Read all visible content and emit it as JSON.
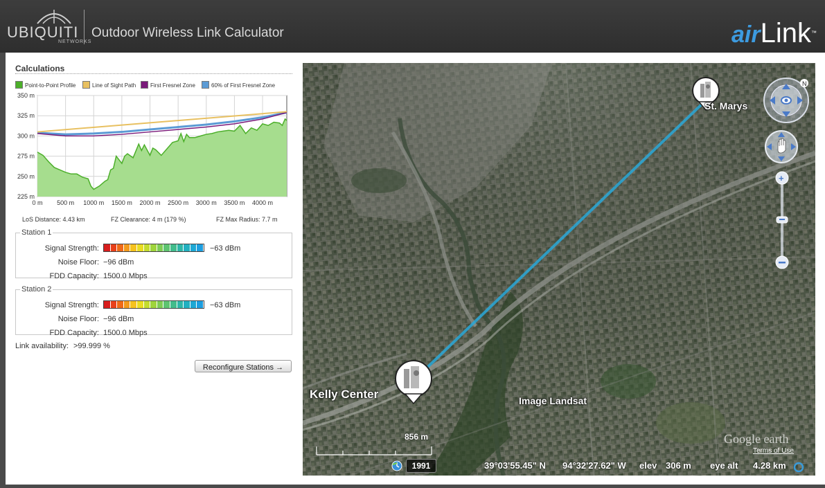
{
  "header": {
    "logo_text": "UBIQUITI",
    "logo_sub": "NETWORKS",
    "title": "Outdoor Wireless Link Calculator",
    "brand_air": "air",
    "brand_link": "Link",
    "brand_tm": "™"
  },
  "calculations": {
    "title": "Calculations",
    "legend": [
      {
        "label": "Point-to-Point Profile",
        "color": "#4caf2a"
      },
      {
        "label": "Line of Sight Path",
        "color": "#e8c060"
      },
      {
        "label": "First Fresnel Zone",
        "color": "#7a1a7a"
      },
      {
        "label": "60% of First Fresnel Zone",
        "color": "#5b9bd5"
      }
    ],
    "stats": {
      "los_distance": "LoS Distance: 4.43 km",
      "fz_clearance": "FZ Clearance: 4 m  (179 %)",
      "fz_max_radius": "FZ Max Radius: 7.7 m"
    }
  },
  "chart_data": {
    "type": "area",
    "title": "",
    "xlabel": "",
    "ylabel": "",
    "x_ticks": [
      "0 m",
      "500 m",
      "1000 m",
      "1500 m",
      "2000 m",
      "2500 m",
      "3000 m",
      "3500 m",
      "4000 m"
    ],
    "y_ticks": [
      "225 m",
      "250 m",
      "275 m",
      "300 m",
      "325 m",
      "350 m"
    ],
    "xlim": [
      0,
      4430
    ],
    "ylim": [
      225,
      350
    ],
    "grid": true,
    "series": [
      {
        "name": "Point-to-Point Profile",
        "color": "#4caf2a",
        "x": [
          0,
          100,
          200,
          300,
          400,
          500,
          600,
          700,
          800,
          900,
          950,
          1000,
          1100,
          1200,
          1250,
          1300,
          1350,
          1400,
          1500,
          1550,
          1600,
          1700,
          1800,
          1850,
          1900,
          2000,
          2050,
          2100,
          2200,
          2300,
          2400,
          2500,
          2550,
          2600,
          2650,
          2700,
          2800,
          2900,
          3000,
          3100,
          3200,
          3300,
          3400,
          3500,
          3600,
          3700,
          3800,
          3900,
          4000,
          4100,
          4200,
          4300,
          4350,
          4400,
          4430
        ],
        "y": [
          280,
          276,
          268,
          261,
          258,
          255,
          253,
          253,
          249,
          247,
          238,
          234,
          238,
          244,
          246,
          258,
          260,
          275,
          266,
          275,
          278,
          273,
          290,
          282,
          289,
          276,
          285,
          283,
          276,
          284,
          292,
          294,
          303,
          293,
          302,
          298,
          298,
          300,
          302,
          303,
          305,
          306,
          307,
          306,
          313,
          303,
          310,
          307,
          315,
          313,
          317,
          316,
          313,
          321,
          319
        ]
      },
      {
        "name": "Line of Sight Path",
        "color": "#e8c060",
        "x": [
          0,
          4430
        ],
        "y": [
          305,
          330
        ]
      },
      {
        "name": "First Fresnel Zone",
        "color": "#7a1a7a",
        "x": [
          0,
          500,
          1000,
          1500,
          2000,
          2500,
          3000,
          3500,
          4000,
          4430
        ],
        "y": [
          303,
          300,
          300,
          302,
          305,
          308,
          311,
          315,
          321,
          329
        ]
      },
      {
        "name": "60% of First Fresnel Zone",
        "color": "#5b9bd5",
        "x": [
          0,
          500,
          1000,
          1500,
          2000,
          2500,
          3000,
          3500,
          4000,
          4430
        ],
        "y": [
          304,
          302,
          303,
          305,
          308,
          311,
          314,
          318,
          323,
          329
        ]
      }
    ]
  },
  "stations": [
    {
      "legend": "Station 1",
      "signal_label": "Signal Strength:",
      "signal_value": "−63 dBm",
      "noise_label": "Noise Floor:",
      "noise_value": "−96 dBm",
      "capacity_label": "FDD Capacity:",
      "capacity_value": "1500.0 Mbps"
    },
    {
      "legend": "Station 2",
      "signal_label": "Signal Strength:",
      "signal_value": "−63 dBm",
      "noise_label": "Noise Floor:",
      "noise_value": "−96 dBm",
      "capacity_label": "FDD Capacity:",
      "capacity_value": "1500.0 Mbps"
    }
  ],
  "meter_colors": [
    "#d81e1e",
    "#e8401a",
    "#ef6a18",
    "#f29a1c",
    "#f5c21e",
    "#e9dc22",
    "#c4dc2e",
    "#9fd43c",
    "#7fcc55",
    "#5ec470",
    "#42bc8c",
    "#2fb6a8",
    "#22b0c0",
    "#1ea8d4",
    "#1c9ee0"
  ],
  "availability": {
    "label": "Link availability:",
    "value": ">99.999 %"
  },
  "reconfigure_label": "Reconfigure Stations →",
  "map": {
    "station_a": "Kelly Center",
    "station_b": "St. Marys",
    "imagery": "Image Landsat",
    "scale": "856 m",
    "year": "1991",
    "latitude": "39°03'55.45\" N",
    "longitude": "94°32'27.62\" W",
    "elev_label": "elev",
    "elev_value": "306 m",
    "eye_alt_label": "eye alt",
    "eye_alt_value": "4.28 km",
    "provider": "Google earth",
    "terms": "Terms of Use",
    "link_color": "#2aa8d8"
  }
}
